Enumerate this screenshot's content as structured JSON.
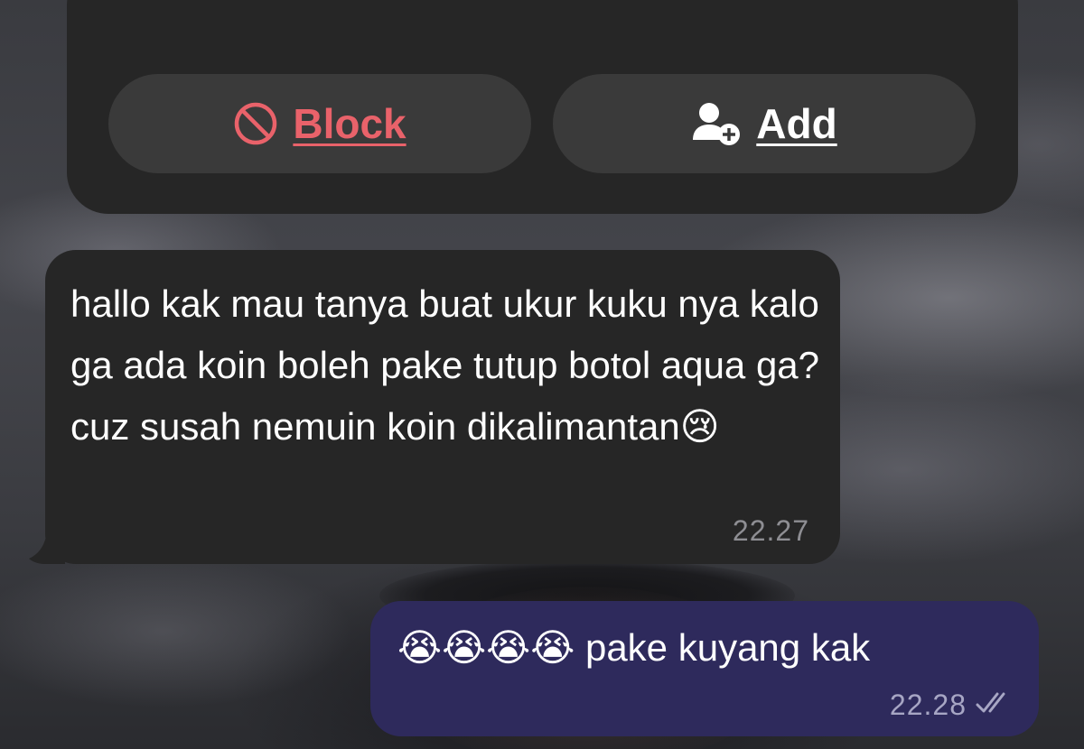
{
  "header_card": {
    "block_label": "Block",
    "add_label": "Add",
    "block_color": "#e9626a"
  },
  "messages": [
    {
      "direction": "incoming",
      "text": "hallo kak mau tanya buat ukur kuku nya kalo ga ada koin boleh pake tutup botol aqua ga? cuz susah nemuin koin dikalimantan😢",
      "time": "22.27"
    },
    {
      "direction": "outgoing",
      "text": "😭😭😭😭 pake kuyang kak",
      "time": "22.28",
      "status_icon": "double-check-icon"
    }
  ],
  "colors": {
    "incoming_bubble": "#262626",
    "outgoing_bubble": "#2e2a5c",
    "card_background": "#262626",
    "button_background": "#3a3a3a"
  }
}
